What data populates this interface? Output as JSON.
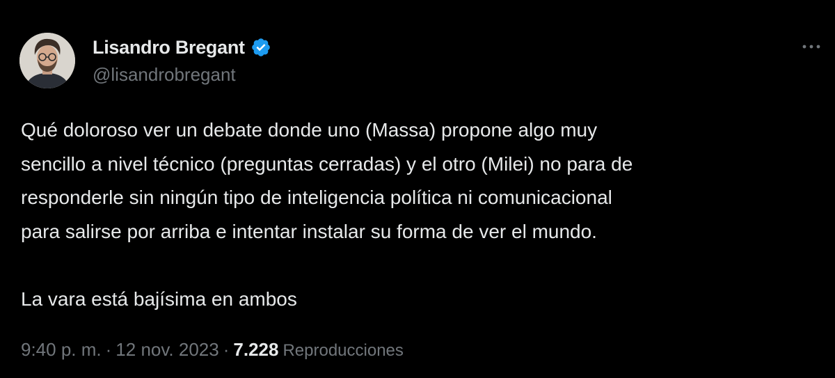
{
  "author": {
    "display_name": "Lisandro Bregant",
    "handle": "@lisandrobregant",
    "verified_icon": "verified-badge-icon",
    "avatar_icon": "avatar"
  },
  "tweet": {
    "text": "Qué doloroso ver un debate donde uno (Massa) propone algo muy\nsencillo a nivel técnico (preguntas cerradas) y el otro (Milei) no para de\nresponderle sin ningún tipo de inteligencia política ni comunicacional\npara salirse por arriba e intentar instalar su forma de ver el mundo.\n\nLa vara está bajísima en ambos",
    "time": "9:40 p. m.",
    "separator": "·",
    "date": "12 nov. 2023",
    "views_count": "7.228",
    "views_label": "Reproducciones"
  },
  "colors": {
    "background": "#000000",
    "primary_text": "#e7e9ea",
    "secondary_text": "#71767b",
    "verified_blue": "#1d9bf0"
  },
  "icons": {
    "more": "more-horizontal-icon"
  }
}
